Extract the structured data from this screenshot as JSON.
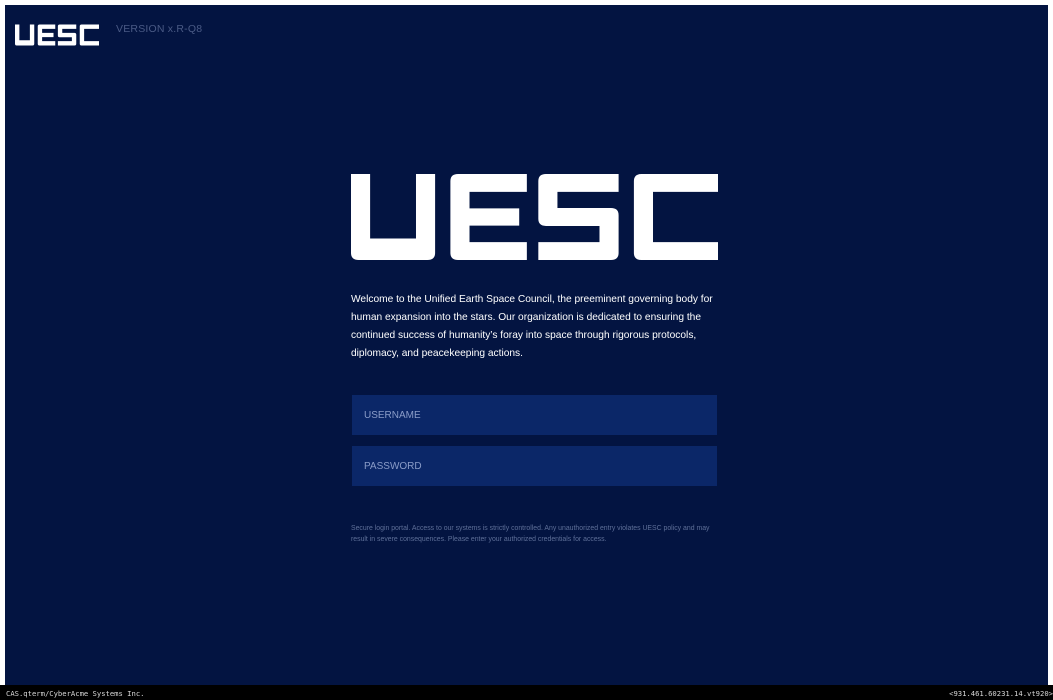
{
  "header": {
    "logo_text": "UESC",
    "version": "VERSION x.R-Q8"
  },
  "hero": {
    "logo_text": "UESC",
    "intro": "Welcome to the Unified Earth Space Council, the preeminent governing body for human expansion into the stars. Our organization is dedicated to ensuring the continued success of humanity’s foray into space through rigorous protocols, diplomacy, and peacekeeping actions."
  },
  "login": {
    "username_placeholder": "USERNAME",
    "username_value": "",
    "password_placeholder": "PASSWORD",
    "password_value": ""
  },
  "notice": "Secure login portal. Access to our systems is strictly controlled. Any unauthorized entry violates UESC policy and may result in severe consequences. Please enter your authorized credentials for access.",
  "statusbar": {
    "left": "CAS.qterm/CyberAcme Systems Inc.",
    "right": "<931.461.60231.14.vt920>"
  },
  "colors": {
    "background": "#031441",
    "field": "#0b2768",
    "logo": "#ffffff",
    "statusbar": "#000000"
  }
}
